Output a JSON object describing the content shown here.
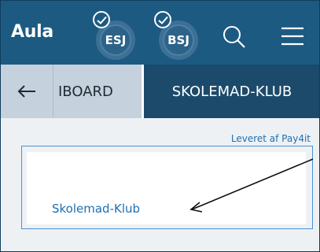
{
  "header": {
    "logo_text": "Aula",
    "avatars": [
      {
        "initials": "ESJ",
        "checked": true
      },
      {
        "initials": "BSJ",
        "checked": true
      }
    ],
    "search_icon": "search-icon",
    "menu_icon": "hamburger-menu-icon"
  },
  "tabs": {
    "back_icon": "arrow-left-icon",
    "items": [
      {
        "label": "IBOARD",
        "active": false
      },
      {
        "label": "SKOLEMAD-KLUB",
        "active": true
      }
    ]
  },
  "content": {
    "provider_text": "Leveret af Pay4it",
    "widget_link": "Skolemad-Klub",
    "annotation_icon": "arrow-annotation-icon"
  },
  "colors": {
    "header_bg": "#1c5a82",
    "active_tab_bg": "#1c4a6b",
    "tab_bar_bg": "#c5d1dc",
    "link": "#1f6fb0",
    "content_bg": "#eef1f4"
  }
}
